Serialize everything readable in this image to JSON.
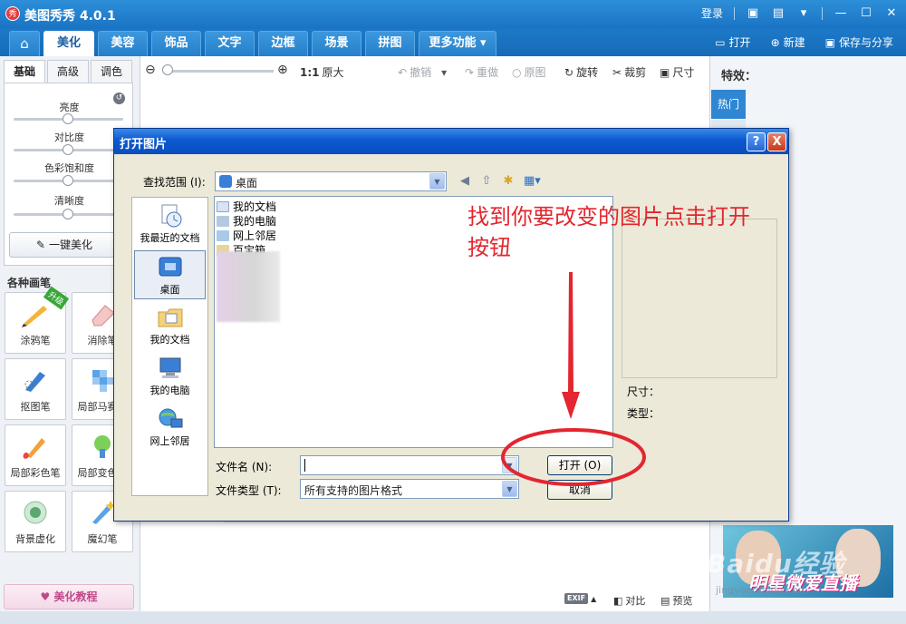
{
  "app": {
    "title": "美图秀秀 4.0.1",
    "logo_text": "秀",
    "login": "登录"
  },
  "menu": {
    "tabs": [
      "美化",
      "美容",
      "饰品",
      "文字",
      "边框",
      "场景",
      "拼图",
      "更多功能"
    ],
    "active_tab": "美化",
    "open": "打开",
    "new": "新建",
    "save_share": "保存与分享"
  },
  "left_panel": {
    "tabs": [
      "基础",
      "高级",
      "调色"
    ],
    "sliders": [
      "亮度",
      "对比度",
      "色彩饱和度",
      "清晰度"
    ],
    "one_key": "一键美化",
    "brush_title": "各种画笔",
    "brushes": [
      "涂鸦笔",
      "消除笔",
      "抠图笔",
      "局部马赛克",
      "局部彩色笔",
      "局部变色笔",
      "背景虚化",
      "魔幻笔"
    ],
    "upgrade_badge": "升级",
    "tutorial": "美化教程"
  },
  "toolbar": {
    "ratio": "1:1",
    "original_size": "原大",
    "undo": "撤销",
    "redo": "重做",
    "original": "原图",
    "rotate": "旋转",
    "crop": "裁剪",
    "size": "尺寸"
  },
  "bottom_bar": {
    "exif": "EXIF",
    "compare": "对比",
    "preview": "预览"
  },
  "right_panel": {
    "title": "特效：",
    "hot_tab": "热门",
    "ad_text": "明星微爱直播",
    "watermark": "Baidu经验",
    "watermark_url": "jingyan.baidu.com"
  },
  "dialog": {
    "title": "打开图片",
    "help": "?",
    "close": "X",
    "look_in_label": "查找范围 (I):",
    "look_in_value": "桌面",
    "places": [
      "我最近的文档",
      "桌面",
      "我的文档",
      "我的电脑",
      "网上邻居"
    ],
    "active_place": "桌面",
    "files": [
      "我的文档",
      "我的电脑",
      "网上邻居",
      "百宝箱"
    ],
    "size_label": "尺寸：",
    "type_label": "类型：",
    "filename_label": "文件名 (N):",
    "filename_value": "",
    "filetype_label": "文件类型 (T):",
    "filetype_value": "所有支持的图片格式",
    "open_button": "打开 (O)",
    "cancel_button": "取消"
  },
  "annotation": {
    "text": "找到你要改变的图片点击打开按钮",
    "color": "#e3262f"
  }
}
